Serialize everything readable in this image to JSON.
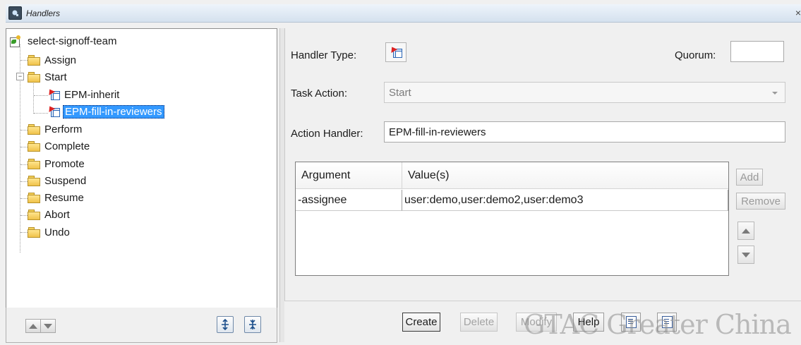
{
  "window": {
    "title": "Handlers",
    "close_glyph": "×"
  },
  "tree": {
    "root": "select-signoff-team",
    "items": [
      {
        "label": "Assign"
      },
      {
        "label": "Start",
        "expanded": true,
        "children": [
          {
            "label": "EPM-inherit"
          },
          {
            "label": "EPM-fill-in-reviewers",
            "selected": true
          }
        ]
      },
      {
        "label": "Perform"
      },
      {
        "label": "Complete"
      },
      {
        "label": "Promote"
      },
      {
        "label": "Suspend"
      },
      {
        "label": "Resume"
      },
      {
        "label": "Abort"
      },
      {
        "label": "Undo"
      }
    ]
  },
  "form": {
    "handler_type_label": "Handler Type:",
    "quorum_label": "Quorum:",
    "quorum_value": "",
    "task_action_label": "Task Action:",
    "task_action_value": "Start",
    "action_handler_label": "Action Handler:",
    "action_handler_value": "EPM-fill-in-reviewers"
  },
  "arguments_table": {
    "headers": [
      "Argument",
      "Value(s)"
    ],
    "rows": [
      {
        "argument": "-assignee",
        "values": "user:demo,user:demo2,user:demo3"
      }
    ]
  },
  "side_buttons": {
    "add": "Add",
    "remove": "Remove"
  },
  "actions": {
    "create": "Create",
    "delete": "Delete",
    "modify": "Modify",
    "help": "Help"
  },
  "watermark": "GTAC Greater China",
  "icons": {
    "tree_root": "process-template-icon",
    "folder": "folder-icon",
    "handler": "handler-icon"
  }
}
